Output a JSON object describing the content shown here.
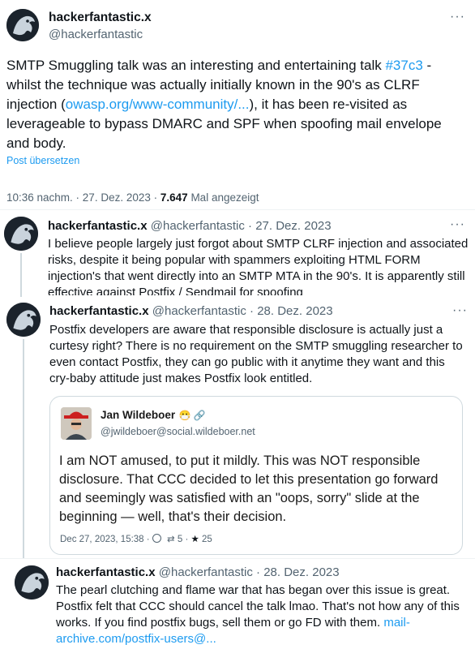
{
  "main_tweet": {
    "display_name": "hackerfantastic.x",
    "handle": "@hackerfantastic",
    "text_parts": [
      "SMTP Smuggling talk was an interesting and entertaining talk ",
      "#37c3",
      " - whilst the technique was actually initially known in the 90's as CLRF injection (",
      "owasp.org/www-community/...",
      "), it has been re-visited as leverageable to bypass DMARC and SPF when spoofing mail envelope and body."
    ],
    "translate": "Post übersetzen",
    "timestamp": "10:36 nachm. · 27. Dez. 2023 ·",
    "views": "7.647",
    "views_label": "Mal angezeigt"
  },
  "replies": [
    {
      "display_name": "hackerfantastic.x",
      "meta": "@hackerfantastic · 27. Dez. 2023",
      "text": "I believe people largely just forgot about SMTP CLRF injection and associated risks, despite it being popular with spammers exploiting HTML FORM injection's that went directly into an SMTP MTA in the 90's. It is apparently still effective against Postfix / Sendmail for spoofing"
    },
    {
      "display_name": "hackerfantastic.x",
      "meta": "@hackerfantastic · 28. Dez. 2023",
      "text": "Postfix developers are aware that responsible disclosure is actually just a curtesy right? There is no requirement on the SMTP smuggling researcher to even contact Postfix, they can go public with it anytime they want and this cry-baby attitude just makes Postfix look entitled.",
      "quote": {
        "name": "Jan Wildeboer",
        "emoji": "😷 🔗",
        "handle": "@jwildeboer@social.wildeboer.net",
        "text": "I am NOT amused, to put it mildly. This was NOT responsible disclosure. That CCC decided to let this presentation go forward and seemingly was satisfied with an \"oops, sorry\" slide at the beginning — well, that's their decision.",
        "date": "Dec 27, 2023, 15:38 ·",
        "boosts": "5",
        "favs": "25"
      }
    },
    {
      "display_name": "hackerfantastic.x",
      "meta": "@hackerfantastic · 28. Dez. 2023",
      "text": "The pearl clutching and flame war that has began over this issue is great. Postfix felt that CCC should cancel the talk lmao. That's not how any of this works. If you find postfix bugs, sell them or go FD with them. ",
      "link": "mail-archive.com/postfix-users@..."
    }
  ],
  "more_glyph": "···"
}
